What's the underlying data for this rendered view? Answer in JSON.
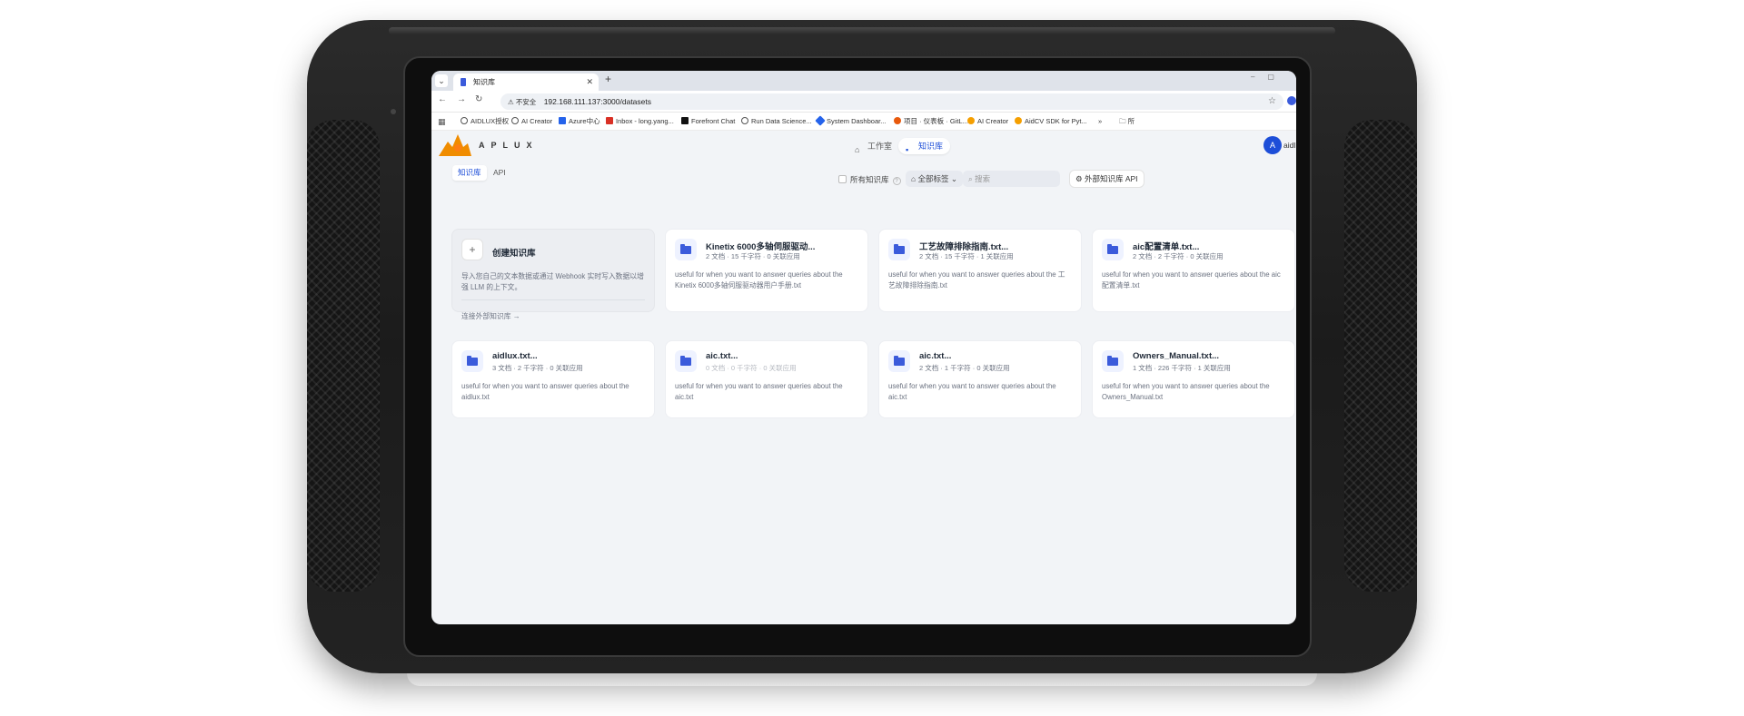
{
  "browser": {
    "tab_title": "知识库",
    "url": "192.168.111.137:3000/datasets",
    "insecure_label": "不安全",
    "bookmarks": [
      {
        "label": "AIDLUX授权",
        "color": "#555555"
      },
      {
        "label": "AI Creator",
        "color": "#555555"
      },
      {
        "label": "Azure中心",
        "color": "#2563eb"
      },
      {
        "label": "Inbox - long.yang...",
        "color": "#d93025"
      },
      {
        "label": "Forefront Chat",
        "color": "#111111"
      },
      {
        "label": "Run Data Science...",
        "color": "#555555"
      },
      {
        "label": "System Dashboar...",
        "color": "#2563eb"
      },
      {
        "label": "项目 · 仪表板 · GitL...",
        "color": "#e8590c"
      },
      {
        "label": "AI Creator",
        "color": "#f59f00"
      },
      {
        "label": "AidCV SDK for Pyt...",
        "color": "#f59f00"
      }
    ],
    "bookmarks_more": "»",
    "bookmarks_folder": "所"
  },
  "app": {
    "logo_text": "APLUX",
    "nav": {
      "studio": "工作室",
      "datasets": "知识库"
    },
    "avatar_letter": "A",
    "username": "aidl"
  },
  "subbar": {
    "tabs": [
      "知识库",
      "API"
    ],
    "all_datasets_label": "所有知识库",
    "tags_label": "全部标签",
    "search_placeholder": "搜索",
    "external_api_label": "外部知识库 API"
  },
  "create_card": {
    "title": "创建知识库",
    "description": "导入您自己的文本数据或通过 Webhook 实时写入数据以增强 LLM 的上下文。",
    "link": "连接外部知识库 →"
  },
  "datasets": [
    {
      "title": "Kinetix 6000多轴伺服驱动...",
      "meta": "2 文档 · 15 千字符 · 0 关联应用",
      "description": "useful for when you want to answer queries about the Kinetix 6000多轴伺服驱动器用户手册.txt"
    },
    {
      "title": "工艺故障排除指南.txt...",
      "meta": "2 文档 · 15 千字符 · 1 关联应用",
      "description": "useful for when you want to answer queries about the 工艺故障排除指南.txt"
    },
    {
      "title": "aic配置清单.txt...",
      "meta": "2 文档 · 2 千字符 · 0 关联应用",
      "description": "useful for when you want to answer queries about the aic配置清单.txt"
    },
    {
      "title": "aidlux.txt...",
      "meta": "3 文档 · 2 千字符 · 0 关联应用",
      "description": "useful for when you want to answer queries about the aidlux.txt"
    },
    {
      "title": "aic.txt...",
      "meta": "0 文档 · 0 千字符 · 0 关联应用",
      "description": "useful for when you want to answer queries about the aic.txt"
    },
    {
      "title": "aic.txt...",
      "meta": "2 文档 · 1 千字符 · 0 关联应用",
      "description": "useful for when you want to answer queries about the aic.txt"
    },
    {
      "title": "Owners_Manual.txt...",
      "meta": "1 文档 · 226 千字符 · 1 关联应用",
      "description": "useful for when you want to answer queries about the Owners_Manual.txt"
    }
  ]
}
